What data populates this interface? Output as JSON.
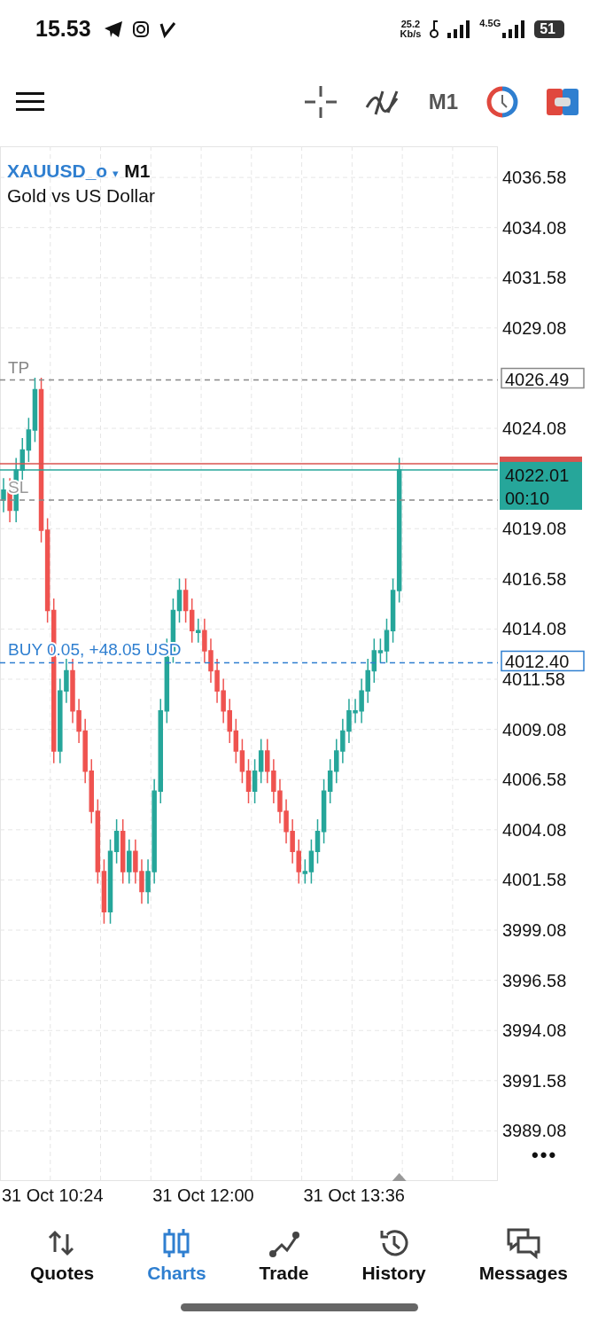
{
  "status_bar": {
    "time": "15.53",
    "net_speed": "25.2",
    "net_unit": "Kb/s",
    "network": "4.5G",
    "battery": "51"
  },
  "toolbar": {
    "timeframe": "M1"
  },
  "chart": {
    "symbol": "XAUUSD_o",
    "caret": "▾",
    "timeframe": "M1",
    "description": "Gold vs US Dollar",
    "price_labels": [
      "4036.58",
      "4034.08",
      "4031.58",
      "4029.08",
      "4024.08",
      "4019.08",
      "4016.58",
      "4014.08",
      "4011.58",
      "4009.08",
      "4006.58",
      "4004.08",
      "4001.58",
      "3999.08",
      "3996.58",
      "3994.08",
      "3991.58",
      "3989.08"
    ],
    "time_labels": [
      "31 Oct 10:24",
      "31 Oct 12:00",
      "31 Oct 13:36"
    ],
    "levels": [
      {
        "kind": "tp",
        "label": "TP",
        "tag": "4026.49"
      },
      {
        "kind": "sl",
        "label": "SL"
      },
      {
        "kind": "buy",
        "label": "BUY 0.05,  +48.05 USD",
        "tag": "4012.40"
      }
    ],
    "bid_label": "4022.01",
    "countdown": "00:10",
    "more": "•••"
  },
  "nav": [
    {
      "label": "Quotes",
      "selected": false
    },
    {
      "label": "Charts",
      "selected": true
    },
    {
      "label": "Trade",
      "selected": false
    },
    {
      "label": "History",
      "selected": false
    },
    {
      "label": "Messages",
      "selected": false
    }
  ]
}
